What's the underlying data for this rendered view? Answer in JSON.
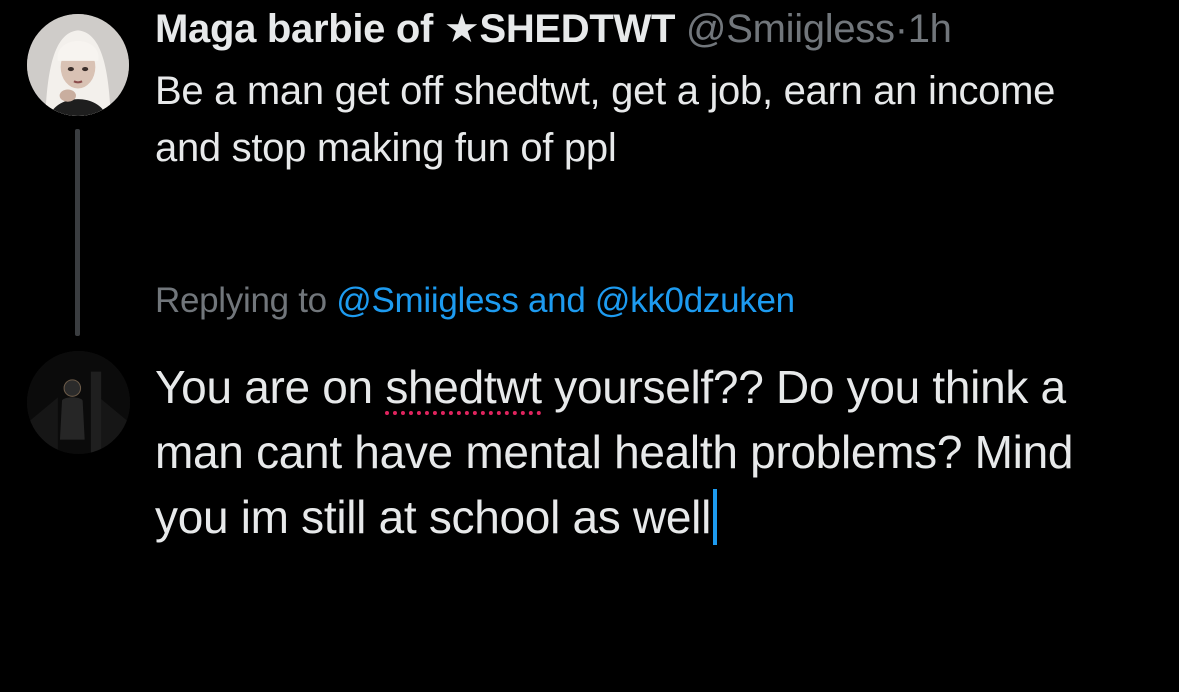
{
  "original_tweet": {
    "display_name": "Maga barbie of ★SHEDTWT",
    "handle": "@Smiigless",
    "separator": "·",
    "timestamp": "1h",
    "text": "Be a man get off shedtwt, get a job, earn an income and stop making fun of ppl"
  },
  "reply": {
    "replying_prefix": "Replying to",
    "mentions": [
      "@Smiigless",
      "@kk0dzuken"
    ],
    "mention_joiner": "and",
    "draft_before_flag": "You are on",
    "draft_flagged_word": "shedtwt",
    "draft_after_flag": "yourself?? Do you think a man cant have mental health problems? Mind you im still at school as well"
  },
  "colors": {
    "background": "#000000",
    "primary_text": "#e7e9ea",
    "secondary_text": "#71767b",
    "accent": "#1d9bf0",
    "spell_error": "#e0245e",
    "thread_line": "#3a3d40"
  },
  "icons": {
    "original_author_avatar": "profile-photo-blonde-woman",
    "reply_author_avatar": "profile-photo-dark-silhouette"
  }
}
